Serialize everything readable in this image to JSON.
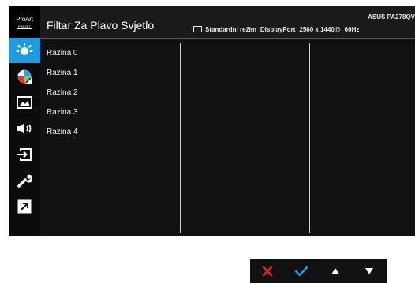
{
  "logo": {
    "line1": "ProArt",
    "line2": "PRESET"
  },
  "sidebar": {
    "items": [
      {
        "icon": "bluelight-filter-icon"
      },
      {
        "icon": "color-palette-icon"
      },
      {
        "icon": "image-icon"
      },
      {
        "icon": "sound-icon"
      },
      {
        "icon": "input-select-icon"
      },
      {
        "icon": "system-setup-icon"
      },
      {
        "icon": "shortcut-icon"
      }
    ],
    "active_color": "#1f9be0"
  },
  "header": {
    "title": "Filtar Za Plavo Svjetlo",
    "mode": "Standardni režim",
    "input": "DisplayPort",
    "resolution": "2560 x 1440@",
    "refresh": "60Hz",
    "model": "ASUS PA278QV"
  },
  "levels": [
    "Razina 0",
    "Razina 1",
    "Razina 2",
    "Razina 3",
    "Razina 4"
  ],
  "buttons": [
    {
      "icon": "close-icon",
      "color": "#e8232a"
    },
    {
      "icon": "check-icon",
      "color": "#1f9be0"
    },
    {
      "icon": "arrow-up-icon",
      "color": "#ffffff"
    },
    {
      "icon": "arrow-down-icon",
      "color": "#ffffff"
    }
  ]
}
